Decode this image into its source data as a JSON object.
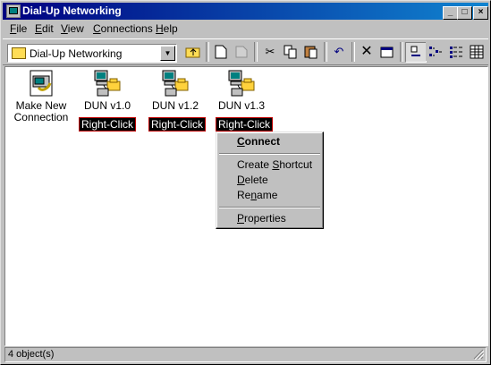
{
  "window": {
    "title": "Dial-Up Networking",
    "controls": {
      "minimize": "_",
      "maximize": "□",
      "close": "×"
    }
  },
  "menubar": [
    {
      "label": "File",
      "accel": "F",
      "rest": "ile"
    },
    {
      "label": "Edit",
      "accel": "E",
      "rest": "dit"
    },
    {
      "label": "View",
      "accel": "V",
      "rest": "iew"
    },
    {
      "label": "Connections",
      "accel": "C",
      "rest": "onnections"
    },
    {
      "label": "Help",
      "accel": "H",
      "rest": "elp"
    }
  ],
  "toolbar": {
    "address_value": "Dial-Up Networking",
    "buttons": [
      "up-folder",
      "map-drive",
      "disconnect-drive",
      "cut",
      "copy",
      "paste",
      "undo",
      "delete",
      "properties",
      "large-icons",
      "small-icons",
      "list",
      "details"
    ]
  },
  "items": [
    {
      "label_line1": "Make New",
      "label_line2": "Connection",
      "icon": "make-new-connection-icon"
    },
    {
      "label": "DUN v1.0",
      "icon": "dun-connection-icon",
      "tag": "Right-Click"
    },
    {
      "label": "DUN v1.2",
      "icon": "dun-connection-icon",
      "tag": "Right-Click"
    },
    {
      "label": "DUN v1.3",
      "icon": "dun-connection-icon",
      "tag": "Right-Click"
    }
  ],
  "context_menu": {
    "connect": {
      "accel": "C",
      "rest": "onnect"
    },
    "create_shortcut": {
      "pre": "Create ",
      "accel": "S",
      "rest": "hortcut"
    },
    "delete": {
      "accel": "D",
      "rest": "elete"
    },
    "rename": {
      "pre": "Re",
      "accel": "n",
      "rest": "ame"
    },
    "properties": {
      "accel": "P",
      "rest": "roperties"
    }
  },
  "status": {
    "text": "4 object(s)"
  },
  "colors": {
    "title_start": "#000080",
    "title_end": "#1084d0",
    "face": "#c0c0c0",
    "tag_border": "#c00000"
  }
}
